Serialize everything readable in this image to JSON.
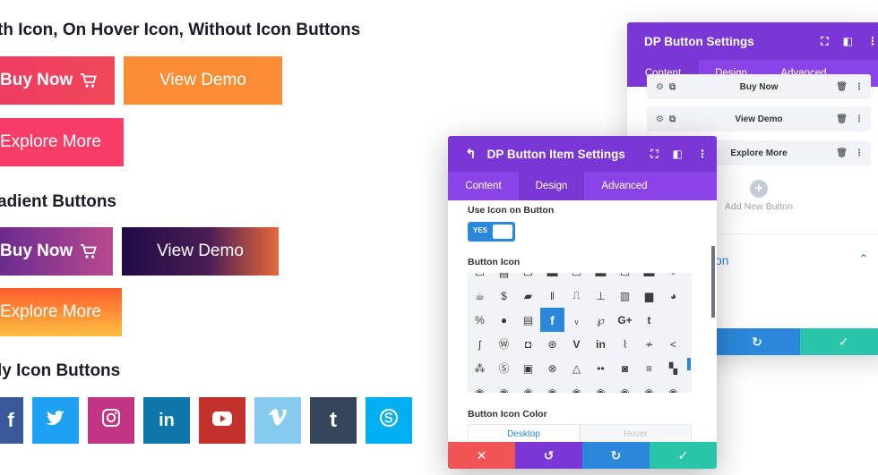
{
  "sections": {
    "with_icon": {
      "heading": "th Icon, On Hover Icon, Without Icon Buttons",
      "buy_now": "Buy Now",
      "view_demo": "View Demo",
      "explore_more": "Explore More"
    },
    "gradient": {
      "heading": "adient Buttons",
      "buy_now": "Buy Now",
      "view_demo": "View Demo",
      "explore_more": "Explore More"
    },
    "only_icon": {
      "heading": "ly Icon Buttons",
      "icons": [
        "f",
        "twitter",
        "instagram",
        "in",
        "youtube",
        "vimeo",
        "t",
        "skype"
      ]
    }
  },
  "back_panel": {
    "title": "DP Button Settings",
    "tabs": [
      "Content",
      "Design",
      "Advanced"
    ],
    "items": [
      "Buy Now",
      "View Demo",
      "Explore More"
    ],
    "add_new": "Add New Button",
    "section_label": "on"
  },
  "front_panel": {
    "title": "DP Button Item Settings",
    "tabs": [
      "Content",
      "Design",
      "Advanced"
    ],
    "use_icon_label": "Use Icon on Button",
    "toggle_value": "YES",
    "button_icon_label": "Button Icon",
    "icon_color_label": "Button Icon Color",
    "color_tabs": [
      "Desktop",
      "Hover"
    ]
  },
  "colors": {
    "purple_header": "#7b36d6",
    "purple_tabs": "#8a43e6",
    "blue": "#2b87da",
    "red": "#ef5555",
    "green": "#29c4a9"
  }
}
